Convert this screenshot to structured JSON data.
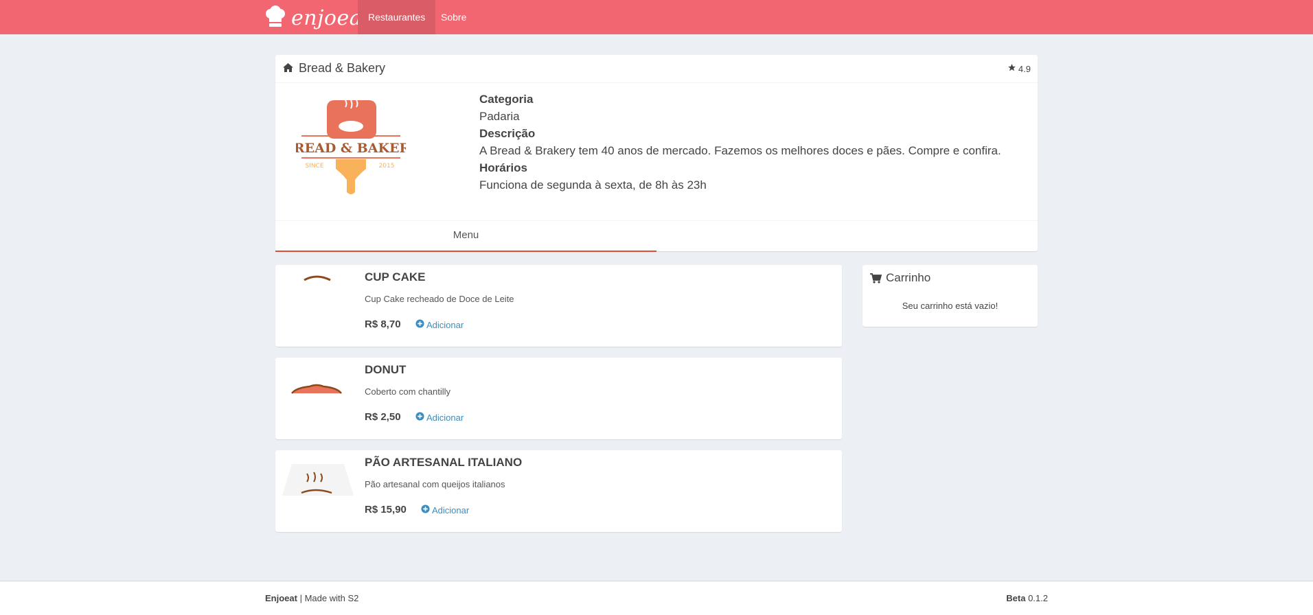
{
  "navbar": {
    "brand": "enjoeat",
    "links": [
      "Restaurantes",
      "Sobre"
    ]
  },
  "restaurant": {
    "name": "Bread & Bakery",
    "rating": "4.9",
    "logo_text": "BREAD & BAKERY",
    "logo_since": "SINCE",
    "logo_year": "2015",
    "category_label": "Categoria",
    "category": "Padaria",
    "description_label": "Descrição",
    "description": "A Bread & Brakery tem 40 anos de mercado. Fazemos os melhores doces e pães. Compre e confira.",
    "hours_label": "Horários",
    "hours": "Funciona de segunda à sexta, de 8h às 23h",
    "tab": "Menu"
  },
  "menu": {
    "items": [
      {
        "name": "CUP CAKE",
        "description": "Cup Cake recheado de Doce de Leite",
        "price": "R$ 8,70",
        "add_label": "Adicionar"
      },
      {
        "name": "DONUT",
        "description": "Coberto com chantilly",
        "price": "R$ 2,50",
        "add_label": "Adicionar"
      },
      {
        "name": "PÃO ARTESANAL ITALIANO",
        "description": "Pão artesanal com queijos italianos",
        "price": "R$ 15,90",
        "add_label": "Adicionar"
      }
    ]
  },
  "cart": {
    "title": "Carrinho",
    "empty_message": "Seu carrinho está vazio!"
  },
  "footer": {
    "brand": "Enjoeat",
    "made_with": "| Made with S2",
    "beta_label": "Beta",
    "version": "0.1.2"
  },
  "colors": {
    "navbar": "#f26671",
    "accent": "#dd4b39",
    "link": "#3c8dbc",
    "logo_orange": "#e8735a",
    "logo_yellow": "#f9b25a",
    "logo_brown": "#8b4a1c"
  },
  "icons": {
    "brand": "chef-hat-icon",
    "title": "home-icon",
    "rating": "star-icon",
    "add": "plus-circle-icon",
    "cart": "shopping-cart-icon"
  }
}
